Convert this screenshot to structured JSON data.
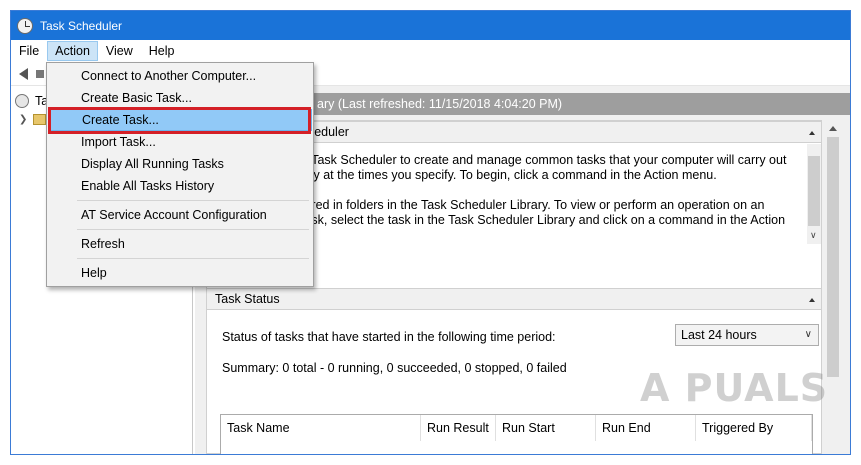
{
  "window": {
    "title": "Task Scheduler"
  },
  "menubar": [
    "File",
    "Action",
    "View",
    "Help"
  ],
  "left_tree": {
    "root_label_partial": "Ta",
    "folder_label_partial": ""
  },
  "summary_header": "ary (Last refreshed: 11/15/2018 4:04:20 PM)",
  "overview": {
    "header": "cheduler",
    "para1_line1": "e Task Scheduler to create and manage common tasks that your computer will carry out",
    "para1_line2": "ally at the times you specify. To begin, click a command in the Action menu.",
    "para2_line1": "tored in folders in the Task Scheduler Library. To view or perform an operation on an",
    "para2_line2": "task, select the task in the Task Scheduler Library and click on a command in the Action"
  },
  "task_status": {
    "header": "Task Status",
    "label": "Status of tasks that have started in the following time period:",
    "period": "Last 24 hours",
    "summary": "Summary: 0 total - 0 running, 0 succeeded, 0 stopped, 0 failed"
  },
  "table_columns": [
    "Task Name",
    "Run Result",
    "Run Start",
    "Run End",
    "Triggered By"
  ],
  "action_menu": {
    "items": [
      "Connect to Another Computer...",
      "Create Basic Task...",
      "Create Task...",
      "Import Task...",
      "Display All Running Tasks",
      "Enable All Tasks History",
      "AT Service Account Configuration",
      "Refresh",
      "Help"
    ],
    "highlighted": "Create Task..."
  },
  "watermark": "A PUALS",
  "colors": {
    "titlebar": "#1a73d8",
    "highlight": "#91c9f7",
    "annotation": "#d42027"
  }
}
